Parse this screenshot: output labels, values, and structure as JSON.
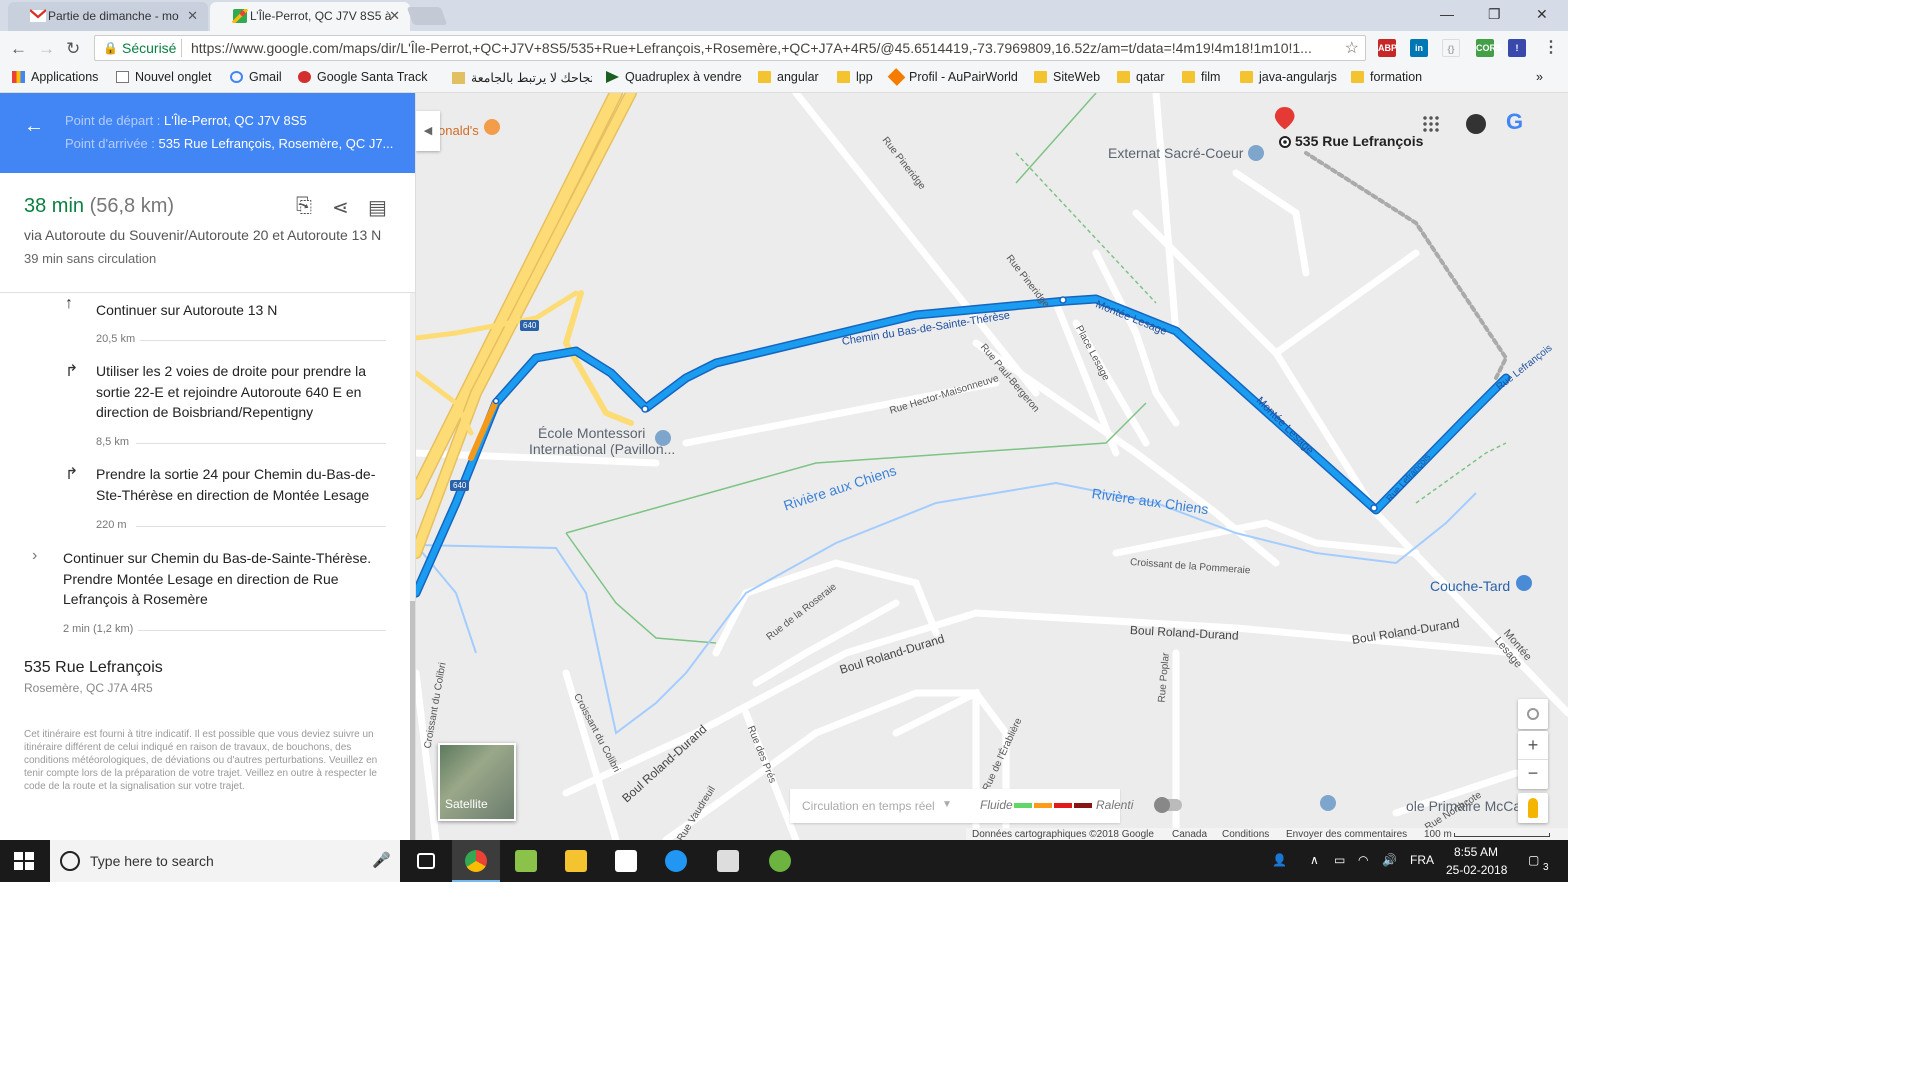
{
  "browser": {
    "tabs": [
      {
        "title": "Partie de dimanche - mo",
        "icon": "gmail-icon"
      },
      {
        "title": "L’Île-Perrot, QC J7V 8S5 à",
        "icon": "google-maps-icon"
      }
    ],
    "address": {
      "security_label": "Sécurisé",
      "url": "https://www.google.com/maps/dir/L'Île-Perrot,+QC+J7V+8S5/535+Rue+Lefrançois,+Rosemère,+QC+J7A+4R5/@45.6514419,-73.7969809,16.52z/am=t/data=!4m19!4m18!1m10!1..."
    },
    "bookmarks": [
      "Applications",
      "Nouvel onglet",
      "Gmail",
      "Google Santa Track",
      "تجاحك لا يرتبط بالجامعة\"",
      "Quadruplex à vendre",
      "angular",
      "lpp",
      "Profil - AuPairWorld",
      "SiteWeb",
      "qatar",
      "film",
      "java-angularjs",
      "formation"
    ],
    "more": "»"
  },
  "directions": {
    "start_label": "Point de départ :",
    "start_value": "L'Île-Perrot, QC J7V 8S5",
    "end_label": "Point d'arrivée :",
    "end_value": "535 Rue Lefrançois, Rosemère, QC J7...",
    "duration": "38 min",
    "distance": "(56,8 km)",
    "via": "via Autoroute du Souvenir/Autoroute 20 et Autoroute 13 N",
    "no_traffic": "39 min sans circulation",
    "steps": [
      {
        "text": "Continuer sur Autoroute 13 N",
        "dist": "20,5 km"
      },
      {
        "text": "Utiliser les 2 voies de droite pour prendre la sortie 22-E et rejoindre Autoroute 640 E en direction de Boisbriand/Repentigny",
        "dist": "8,5 km"
      },
      {
        "text": "Prendre la sortie 24 pour Chemin du-Bas-de-Ste-Thérèse en direction de Montée Lesage",
        "dist": "220 m"
      },
      {
        "text": "Continuer sur Chemin du Bas-de-Sainte-Thérèse. Prendre Montée Lesage en direction de Rue Lefrançois à Rosemère",
        "dist": "2 min (1,2 km)"
      }
    ],
    "destination_title": "535 Rue Lefrançois",
    "destination_sub": "Rosemère, QC J7A 4R5",
    "disclaimer": "Cet itinéraire est fourni à titre indicatif. Il est possible que vous deviez suivre un itinéraire différent de celui indiqué en raison de travaux, de bouchons, des conditions météorologiques, de déviations ou d'autres perturbations. Veuillez en tenir compte lors de la préparation de votre trajet. Veillez en outre à respecter le code de la route et la signalisation sur votre trajet."
  },
  "map": {
    "labels": {
      "mcd": "onald's",
      "externat": "Externat Sacré-Coeur",
      "destination": "535 Rue Lefrançois",
      "ecole1": "École Montessori",
      "ecole2": "International (Pavillon...",
      "riviere1": "Rivière aux Chiens",
      "riviere2": "Rivière aux Chiens",
      "chemin": "Chemin du Bas-de-Sainte-Thérèse",
      "montee1": "Montée Lesage",
      "montee2": "Montée Lesage",
      "montee3": "Montée Lesage",
      "pineridge1": "Rue Pineridge",
      "pineridge2": "Rue Pineridge",
      "place_lesage": "Place Lesage",
      "paul_bergeron": "Rue Paul-Bergeron",
      "hector": "Rue Hector-Maisonneuve",
      "lefrancois1": "Rue Lefrançois",
      "lefrancois2": "Rue Lefrançois",
      "pommeraie": "Croissant de la Pommeraie",
      "roseraie": "Rue de la Roseraie",
      "roland1": "Boul Roland-Durand",
      "roland2": "Boul Roland-Durand",
      "roland3": "Boul Roland-Durand",
      "roland4": "Boul Roland-Durand",
      "poplar": "Rue Poplar",
      "colibri": "Croissant du Colibri",
      "colibri2": "Croissant du Colibri",
      "pres": "Rue des Prés",
      "vaudreuil": "Rue Vaudreuil",
      "erabliere": "Rue de l'Érablière",
      "northcote": "Rue Northcote",
      "couche_tard": "Couche-Tard",
      "mccaig": "ole Primaire McCaig",
      "hw640a": "640",
      "hw640b": "640",
      "realtime": "Circulation en temps réel",
      "fluide": "Fluide",
      "ralenti": "Ralenti",
      "satellite": "Satellite"
    },
    "footer": {
      "copyright": "Données cartographiques ©2018 Google",
      "country": "Canada",
      "conditions": "Conditions",
      "feedback": "Envoyer des commentaires",
      "scale": "100 m"
    },
    "colors": {
      "route": "#1a9cf0",
      "route_border": "#1565c0",
      "slow": "#f49a1b",
      "highway": "#fddc76",
      "water": "#a3ccff",
      "park": "#7dc383"
    }
  },
  "taskbar": {
    "search_placeholder": "Type here to search",
    "lang": "FRA",
    "time": "8:55 AM",
    "date": "25-02-2018",
    "notifications": "3"
  }
}
